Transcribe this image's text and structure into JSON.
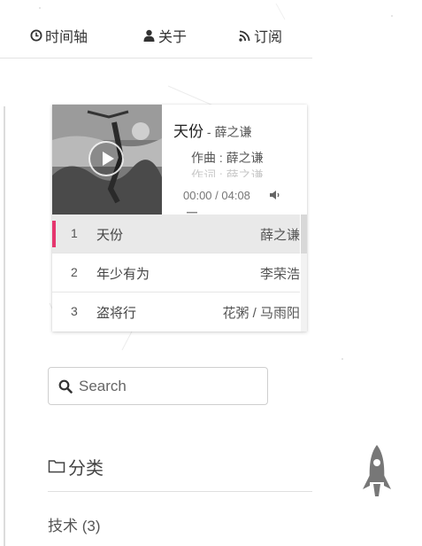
{
  "nav": {
    "timeline": {
      "label": "时间轴",
      "icon": "clock-icon"
    },
    "about": {
      "label": "关于",
      "icon": "user-icon"
    },
    "rss": {
      "label": "订阅",
      "icon": "rss-icon"
    }
  },
  "player": {
    "song_title": "天份",
    "separator": " - ",
    "song_artist": "薛之谦",
    "lyrics": [
      "作曲 : 薛之谦",
      "作词 : 薛之谦"
    ],
    "time": "00:00 / 04:08",
    "accent_color": "#e5366e",
    "playlist": [
      {
        "num": "1",
        "title": "天份",
        "author": "薛之谦",
        "active": true
      },
      {
        "num": "2",
        "title": "年少有为",
        "author": "李荣浩",
        "active": false
      },
      {
        "num": "3",
        "title": "盗将行",
        "author": "花粥 / 马雨阳",
        "active": false
      }
    ]
  },
  "search": {
    "placeholder": "Search"
  },
  "categories": {
    "header": "分类",
    "items": [
      {
        "label": "技术 (3)"
      }
    ]
  }
}
